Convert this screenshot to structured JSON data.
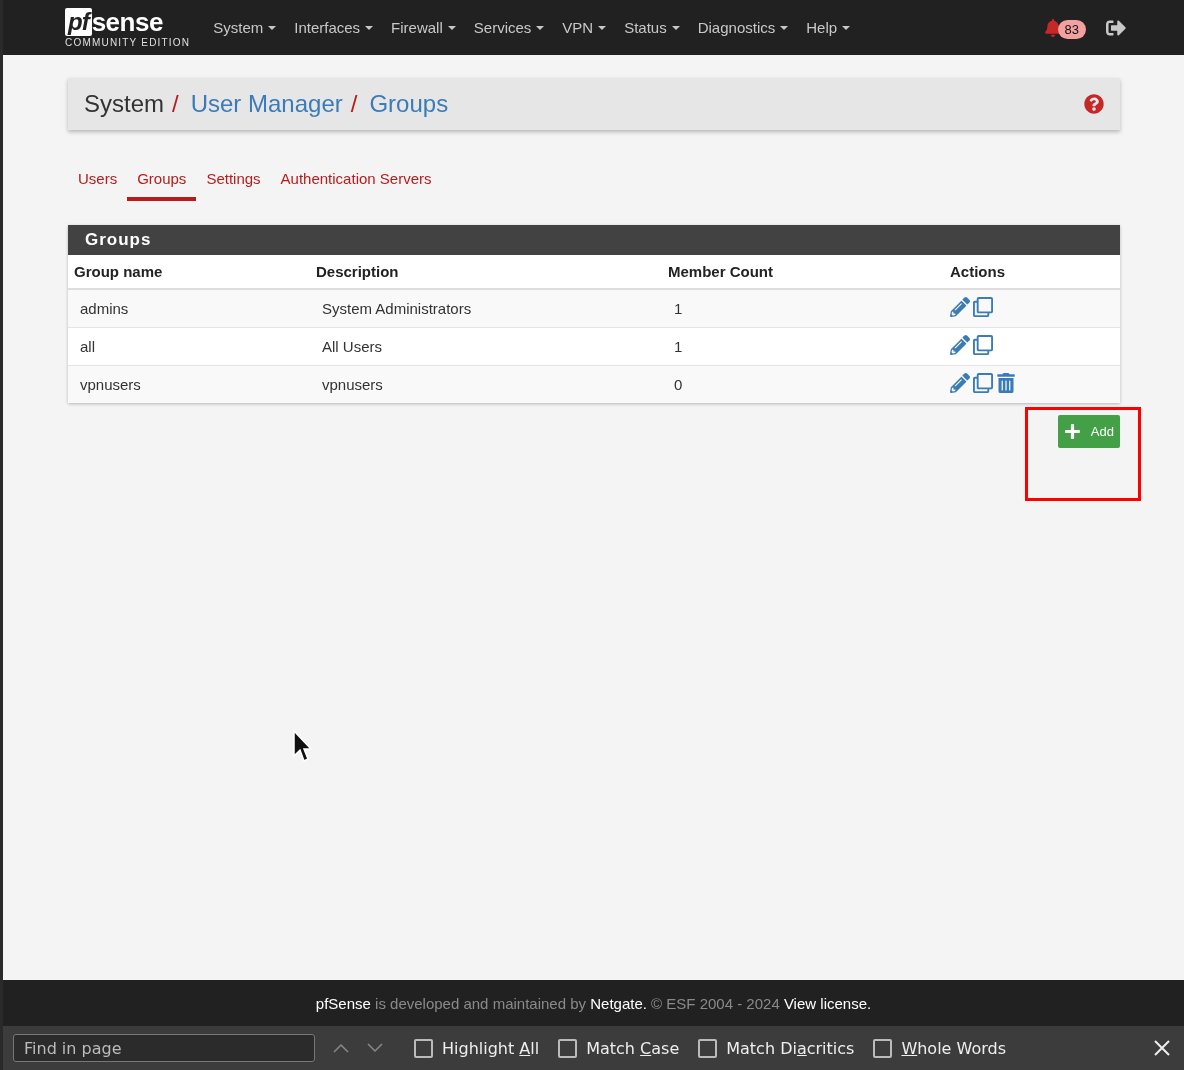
{
  "navbar": {
    "logo": {
      "mark": "pf",
      "word": "sense",
      "edition": "COMMUNITY EDITION"
    },
    "menus": [
      {
        "label": "System"
      },
      {
        "label": "Interfaces"
      },
      {
        "label": "Firewall"
      },
      {
        "label": "Services"
      },
      {
        "label": "VPN"
      },
      {
        "label": "Status"
      },
      {
        "label": "Diagnostics"
      },
      {
        "label": "Help"
      }
    ],
    "notifications": "83"
  },
  "breadcrumb": [
    {
      "label": "System",
      "kind": "plain",
      "separator": "/"
    },
    {
      "label": "User Manager",
      "kind": "link",
      "separator": "/"
    },
    {
      "label": "Groups",
      "kind": "link"
    }
  ],
  "tabs": [
    {
      "label": "Users",
      "selected": false
    },
    {
      "label": "Groups",
      "selected": true
    },
    {
      "label": "Settings",
      "selected": false
    },
    {
      "label": "Authentication Servers",
      "selected": false
    }
  ],
  "panel": {
    "title": "Groups",
    "columns": [
      "Group name",
      "Description",
      "Member Count",
      "Actions"
    ],
    "rows": [
      {
        "name": "admins",
        "description": "System Administrators",
        "members": "1",
        "actions": [
          {
            "kind": "edit"
          },
          {
            "kind": "copy"
          }
        ]
      },
      {
        "name": "all",
        "description": "All Users",
        "members": "1",
        "actions": [
          {
            "kind": "edit"
          },
          {
            "kind": "copy"
          }
        ]
      },
      {
        "name": "vpnusers",
        "description": "vpnusers",
        "members": "0",
        "actions": [
          {
            "kind": "edit"
          },
          {
            "kind": "copy"
          },
          {
            "kind": "delete"
          }
        ]
      }
    ],
    "add_button": {
      "label": "Add",
      "highlighted": true
    }
  },
  "footer": [
    {
      "text": "pfSense",
      "kind": "brand"
    },
    {
      "text": " is developed and maintained by ",
      "kind": "plain"
    },
    {
      "text": "Netgate.",
      "kind": "brand"
    },
    {
      "text": " © ESF 2004 - 2024 ",
      "kind": "plain"
    },
    {
      "text": "View license.",
      "kind": "link"
    }
  ],
  "find_bar": {
    "placeholder": "Find in page",
    "options": [
      {
        "before": "Highlight ",
        "key": "A",
        "after": "ll",
        "checked": false
      },
      {
        "before": "Match ",
        "key": "C",
        "after": "ase",
        "checked": false
      },
      {
        "before": "Match Di",
        "key": "a",
        "after": "critics",
        "checked": false
      },
      {
        "key": "W",
        "after": "hole Words",
        "checked": false
      }
    ]
  }
}
